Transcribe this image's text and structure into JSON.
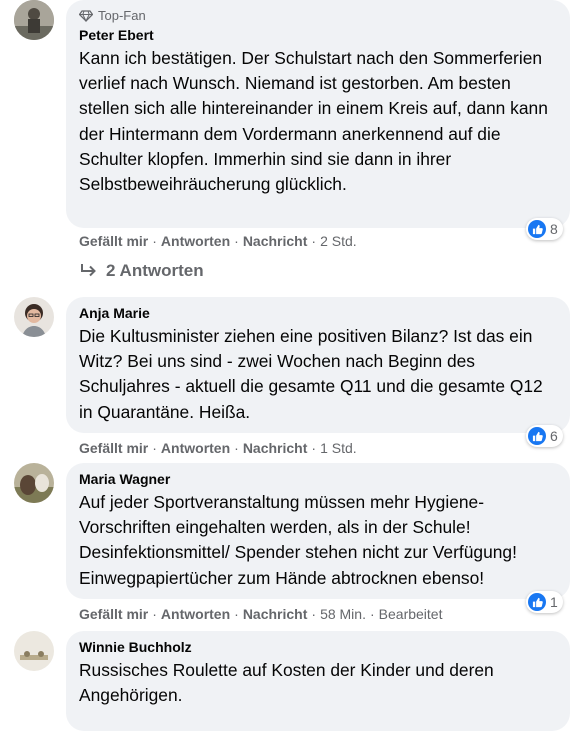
{
  "comments": [
    {
      "badge": "Top-Fan",
      "author": "Peter Ebert",
      "text": "Kann ich bestätigen. Der Schulstart nach den Sommerferien verlief nach Wunsch. Niemand ist gestorben. Am besten stellen sich alle hintereinander in einem Kreis auf, dann kann der Hintermann dem Vordermann anerkennend auf die Schulter klopfen. Immerhin sind sie dann in ihrer Selbstbeweihräucherung glücklich.",
      "like": "Gefällt mir",
      "reply": "Antworten",
      "message": "Nachricht",
      "time": "2 Std.",
      "reactions": "8",
      "replies_label": "2 Antworten"
    },
    {
      "author": "Anja Marie",
      "text": "Die Kultusminister ziehen eine positiven Bilanz? Ist das ein Witz? Bei uns sind - zwei Wochen nach Beginn des Schuljahres - aktuell die gesamte Q11 und die gesamte Q12 in Quarantäne. Heißa.",
      "like": "Gefällt mir",
      "reply": "Antworten",
      "message": "Nachricht",
      "time": "1 Std.",
      "reactions": "6"
    },
    {
      "author": "Maria Wagner",
      "text": "Auf jeder Sportveranstaltung müssen mehr Hygiene-Vorschriften eingehalten werden, als in der Schule! Desinfektionsmittel/ Spender stehen nicht zur Verfügung! Einwegpapiertücher zum Hände abtrocknen ebenso!",
      "like": "Gefällt mir",
      "reply": "Antworten",
      "message": "Nachricht",
      "time": "58 Min.",
      "edited": "Bearbeitet",
      "reactions": "1"
    },
    {
      "author": "Winnie Buchholz",
      "text": "Russisches Roulette auf Kosten der Kinder und deren Angehörigen."
    }
  ],
  "colors": {
    "bubble": "#f0f2f5",
    "meta": "#65676b",
    "like": "#1877f2"
  }
}
